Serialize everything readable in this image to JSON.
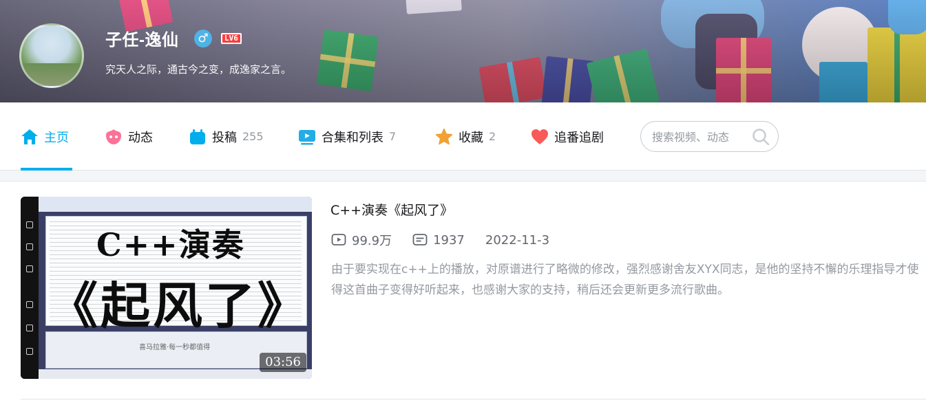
{
  "user": {
    "name": "子任-逸仙",
    "gender_symbol": "♂",
    "level_badge": "LV6",
    "signature": "究天人之际，通古今之变，成逸家之言。"
  },
  "nav": {
    "tabs": [
      {
        "label": "主页",
        "count": "",
        "icon": "home-icon",
        "active": true,
        "color": "#00aeec"
      },
      {
        "label": "动态",
        "count": "",
        "icon": "dynamic-icon",
        "color": "#fb7299"
      },
      {
        "label": "投稿",
        "count": "255",
        "icon": "upload-icon",
        "color": "#00aeec"
      },
      {
        "label": "合集和列表",
        "count": "7",
        "icon": "playlist-icon",
        "color": "#23ade5"
      },
      {
        "label": "收藏",
        "count": "2",
        "icon": "star-icon",
        "color": "#f3a034"
      },
      {
        "label": "追番追剧",
        "count": "",
        "icon": "heart-icon",
        "color": "#fa5a57"
      }
    ],
    "search_placeholder": "搜索视频、动态"
  },
  "video": {
    "title": "C++演奏《起风了》",
    "thumbnail_title_line1": "C++演奏",
    "thumbnail_title_line2": "《起风了》",
    "thumbnail_caption": "喜马拉雅·每一秒都值得",
    "duration": "03:56",
    "views": "99.9万",
    "danmaku": "1937",
    "date": "2022-11-3",
    "description": "由于要实现在c++上的播放，对原谱进行了略微的修改，强烈感谢舍友XYX同志，是他的坚持不懈的乐理指导才使得这首曲子变得好听起来，也感谢大家的支持，稍后还会更新更多流行歌曲。"
  },
  "colors": {
    "accent": "#00aeec",
    "text_primary": "#18191c",
    "text_secondary": "#9499a0"
  }
}
